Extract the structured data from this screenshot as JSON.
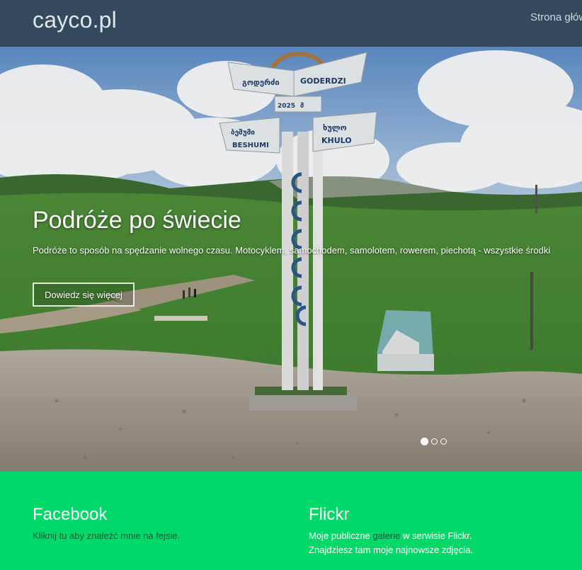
{
  "navbar": {
    "brand": "cayco.pl",
    "links": [
      {
        "label": "Strona głów"
      }
    ]
  },
  "hero": {
    "title": "Podróże po świecie",
    "text": "Podróże to sposób na spędzanie wolnego czasu. Motocyklem, samochodem, samolotem, rowerem, piechotą - wszystkie środki",
    "button_label": "Dowiedz się więcej",
    "sign": {
      "top_left": "გოდერძი",
      "top_right": "GODERDZI",
      "year": "2025",
      "unit": "მ",
      "left_script": "ბეშუმი",
      "left_latin": "BESHUMI",
      "right_script": "ხულო",
      "right_latin": "KHULO"
    },
    "carousel": {
      "slides": 3,
      "active_index": 0
    }
  },
  "footer": {
    "facebook": {
      "title": "Facebook",
      "text": "Kliknij tu aby znaleźć mnie na fejsie."
    },
    "flickr": {
      "title": "Flickr",
      "line1_a": "Moje publiczne ",
      "line1_link": "galerie",
      "line1_b": " w serwisie Flickr.",
      "line2": "Znajdziesz tam moje najnowsze zdjęcia."
    }
  },
  "colors": {
    "navbar_bg": "#34495e",
    "footer_bg": "#00d86a",
    "accent_dark": "#0d5a3b"
  }
}
